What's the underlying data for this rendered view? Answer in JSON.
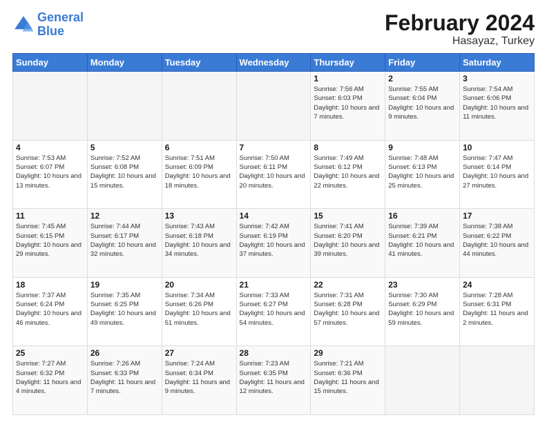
{
  "header": {
    "logo_line1": "General",
    "logo_line2": "Blue",
    "title": "February 2024",
    "subtitle": "Hasayaz, Turkey"
  },
  "weekdays": [
    "Sunday",
    "Monday",
    "Tuesday",
    "Wednesday",
    "Thursday",
    "Friday",
    "Saturday"
  ],
  "weeks": [
    [
      {
        "day": "",
        "info": ""
      },
      {
        "day": "",
        "info": ""
      },
      {
        "day": "",
        "info": ""
      },
      {
        "day": "",
        "info": ""
      },
      {
        "day": "1",
        "info": "Sunrise: 7:56 AM\nSunset: 6:03 PM\nDaylight: 10 hours and 7 minutes."
      },
      {
        "day": "2",
        "info": "Sunrise: 7:55 AM\nSunset: 6:04 PM\nDaylight: 10 hours and 9 minutes."
      },
      {
        "day": "3",
        "info": "Sunrise: 7:54 AM\nSunset: 6:06 PM\nDaylight: 10 hours and 11 minutes."
      }
    ],
    [
      {
        "day": "4",
        "info": "Sunrise: 7:53 AM\nSunset: 6:07 PM\nDaylight: 10 hours and 13 minutes."
      },
      {
        "day": "5",
        "info": "Sunrise: 7:52 AM\nSunset: 6:08 PM\nDaylight: 10 hours and 15 minutes."
      },
      {
        "day": "6",
        "info": "Sunrise: 7:51 AM\nSunset: 6:09 PM\nDaylight: 10 hours and 18 minutes."
      },
      {
        "day": "7",
        "info": "Sunrise: 7:50 AM\nSunset: 6:11 PM\nDaylight: 10 hours and 20 minutes."
      },
      {
        "day": "8",
        "info": "Sunrise: 7:49 AM\nSunset: 6:12 PM\nDaylight: 10 hours and 22 minutes."
      },
      {
        "day": "9",
        "info": "Sunrise: 7:48 AM\nSunset: 6:13 PM\nDaylight: 10 hours and 25 minutes."
      },
      {
        "day": "10",
        "info": "Sunrise: 7:47 AM\nSunset: 6:14 PM\nDaylight: 10 hours and 27 minutes."
      }
    ],
    [
      {
        "day": "11",
        "info": "Sunrise: 7:45 AM\nSunset: 6:15 PM\nDaylight: 10 hours and 29 minutes."
      },
      {
        "day": "12",
        "info": "Sunrise: 7:44 AM\nSunset: 6:17 PM\nDaylight: 10 hours and 32 minutes."
      },
      {
        "day": "13",
        "info": "Sunrise: 7:43 AM\nSunset: 6:18 PM\nDaylight: 10 hours and 34 minutes."
      },
      {
        "day": "14",
        "info": "Sunrise: 7:42 AM\nSunset: 6:19 PM\nDaylight: 10 hours and 37 minutes."
      },
      {
        "day": "15",
        "info": "Sunrise: 7:41 AM\nSunset: 6:20 PM\nDaylight: 10 hours and 39 minutes."
      },
      {
        "day": "16",
        "info": "Sunrise: 7:39 AM\nSunset: 6:21 PM\nDaylight: 10 hours and 41 minutes."
      },
      {
        "day": "17",
        "info": "Sunrise: 7:38 AM\nSunset: 6:22 PM\nDaylight: 10 hours and 44 minutes."
      }
    ],
    [
      {
        "day": "18",
        "info": "Sunrise: 7:37 AM\nSunset: 6:24 PM\nDaylight: 10 hours and 46 minutes."
      },
      {
        "day": "19",
        "info": "Sunrise: 7:35 AM\nSunset: 6:25 PM\nDaylight: 10 hours and 49 minutes."
      },
      {
        "day": "20",
        "info": "Sunrise: 7:34 AM\nSunset: 6:26 PM\nDaylight: 10 hours and 51 minutes."
      },
      {
        "day": "21",
        "info": "Sunrise: 7:33 AM\nSunset: 6:27 PM\nDaylight: 10 hours and 54 minutes."
      },
      {
        "day": "22",
        "info": "Sunrise: 7:31 AM\nSunset: 6:28 PM\nDaylight: 10 hours and 57 minutes."
      },
      {
        "day": "23",
        "info": "Sunrise: 7:30 AM\nSunset: 6:29 PM\nDaylight: 10 hours and 59 minutes."
      },
      {
        "day": "24",
        "info": "Sunrise: 7:28 AM\nSunset: 6:31 PM\nDaylight: 11 hours and 2 minutes."
      }
    ],
    [
      {
        "day": "25",
        "info": "Sunrise: 7:27 AM\nSunset: 6:32 PM\nDaylight: 11 hours and 4 minutes."
      },
      {
        "day": "26",
        "info": "Sunrise: 7:26 AM\nSunset: 6:33 PM\nDaylight: 11 hours and 7 minutes."
      },
      {
        "day": "27",
        "info": "Sunrise: 7:24 AM\nSunset: 6:34 PM\nDaylight: 11 hours and 9 minutes."
      },
      {
        "day": "28",
        "info": "Sunrise: 7:23 AM\nSunset: 6:35 PM\nDaylight: 11 hours and 12 minutes."
      },
      {
        "day": "29",
        "info": "Sunrise: 7:21 AM\nSunset: 6:36 PM\nDaylight: 11 hours and 15 minutes."
      },
      {
        "day": "",
        "info": ""
      },
      {
        "day": "",
        "info": ""
      }
    ]
  ]
}
